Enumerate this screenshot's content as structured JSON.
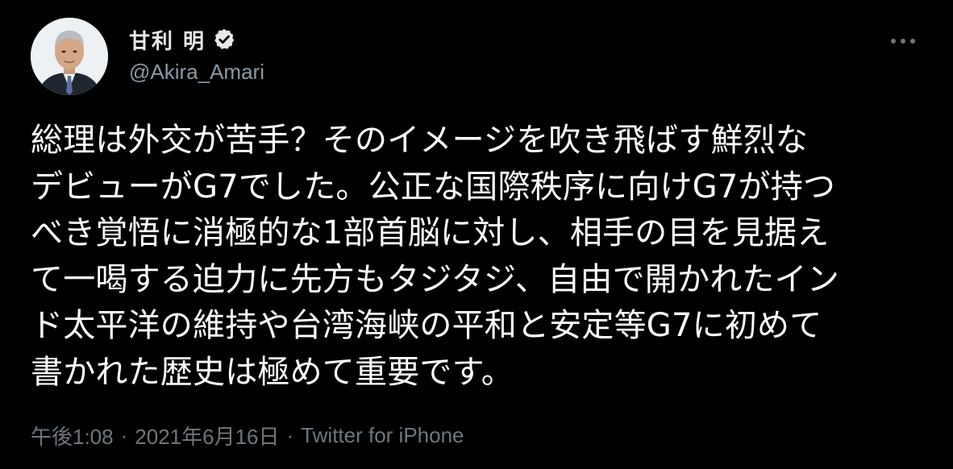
{
  "tweet": {
    "author": {
      "display_name": "甘利 明",
      "handle": "@Akira_Amari",
      "verified": true,
      "avatar_icon": "user-avatar"
    },
    "more_icon": "more-options-icon",
    "text_lines": [
      "総理は外交が苦手？そのイメージを吹き飛ばす鮮烈な",
      "デビューがG7でした。公正な国際秩序に向けG7が持つ",
      "べき覚悟に消極的な1部首脳に対し、相手の目を見据え",
      "て一喝する迫力に先方もタジタジ、自由で開かれたイン",
      "ド太平洋の維持や台湾海峡の平和と安定等G7に初めて",
      "書かれた歴史は極めて重要です。"
    ],
    "meta": {
      "time": "午後1:08",
      "separator": "·",
      "date": "2021年6月16日",
      "source": "Twitter for iPhone"
    }
  },
  "colors": {
    "background": "#000000",
    "text": "#ffffff",
    "secondary": "#8b98a5",
    "meta": "#6e767d",
    "verified_badge": "#e7e9ea"
  }
}
